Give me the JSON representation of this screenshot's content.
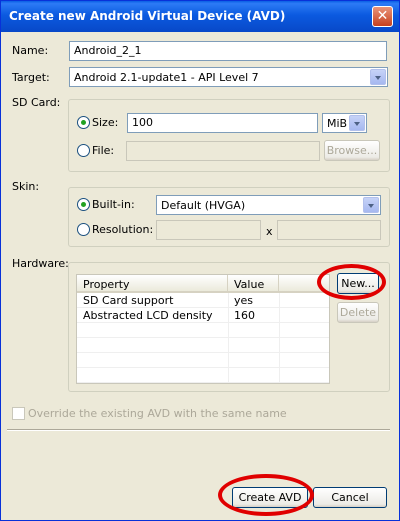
{
  "window": {
    "title": "Create new Android Virtual Device (AVD)",
    "close_glyph": "✕"
  },
  "name": {
    "label": "Name:",
    "value": "Android_2_1"
  },
  "target": {
    "label": "Target:",
    "value": "Android 2.1-update1 - API Level 7"
  },
  "sdcard": {
    "label": "SD Card:",
    "size_label": "Size:",
    "size_value": "100",
    "unit": "MiB",
    "file_label": "File:",
    "file_value": "",
    "browse_label": "Browse..."
  },
  "skin": {
    "label": "Skin:",
    "builtin_label": "Built-in:",
    "builtin_value": "Default (HVGA)",
    "resolution_label": "Resolution:",
    "res_separator": "x"
  },
  "hardware": {
    "label": "Hardware:",
    "columns": [
      "Property",
      "Value"
    ],
    "rows": [
      {
        "property": "SD Card support",
        "value": "yes"
      },
      {
        "property": "Abstracted LCD density",
        "value": "160"
      }
    ],
    "new_label": "New...",
    "delete_label": "Delete"
  },
  "override_label": "Override the existing AVD with the same name",
  "buttons": {
    "create": "Create AVD",
    "cancel": "Cancel"
  },
  "highlight_color": "#E00000"
}
